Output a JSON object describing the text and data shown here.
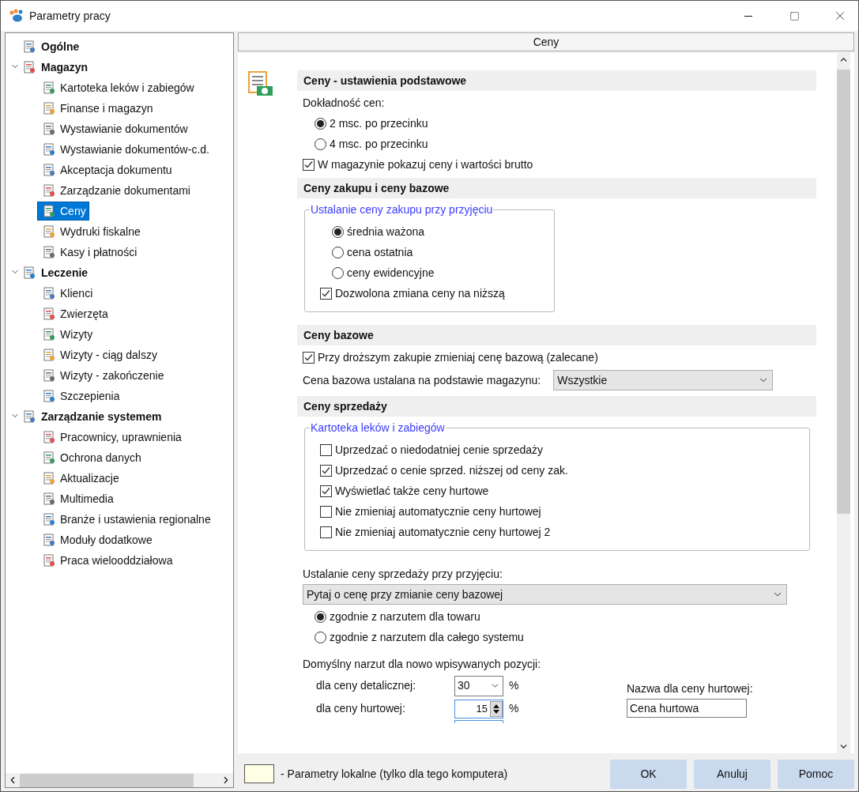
{
  "window": {
    "title": "Parametry pracy"
  },
  "tree": [
    {
      "label": "Ogólne",
      "selected": false
    },
    {
      "label": "Magazyn",
      "expanded": true,
      "selected": false,
      "children": [
        {
          "label": "Kartoteka leków i zabiegów",
          "selected": false
        },
        {
          "label": "Finanse i magazyn",
          "selected": false
        },
        {
          "label": "Wystawianie dokumentów",
          "selected": false
        },
        {
          "label": "Wystawianie dokumentów-c.d.",
          "selected": false
        },
        {
          "label": "Akceptacja dokumentu",
          "selected": false
        },
        {
          "label": "Zarządzanie dokumentami",
          "selected": false
        },
        {
          "label": "Ceny",
          "selected": true
        },
        {
          "label": "Wydruki fiskalne",
          "selected": false
        },
        {
          "label": "Kasy i płatności",
          "selected": false
        }
      ]
    },
    {
      "label": "Leczenie",
      "expanded": true,
      "selected": false,
      "children": [
        {
          "label": "Klienci",
          "selected": false
        },
        {
          "label": "Zwierzęta",
          "selected": false
        },
        {
          "label": "Wizyty",
          "selected": false
        },
        {
          "label": "Wizyty - ciąg dalszy",
          "selected": false
        },
        {
          "label": "Wizyty - zakończenie",
          "selected": false
        },
        {
          "label": "Szczepienia",
          "selected": false
        }
      ]
    },
    {
      "label": "Zarządzanie systemem",
      "expanded": true,
      "selected": false,
      "children": [
        {
          "label": "Pracownicy, uprawnienia",
          "selected": false
        },
        {
          "label": "Ochrona danych",
          "selected": false
        },
        {
          "label": "Aktualizacje",
          "selected": false
        },
        {
          "label": "Multimedia",
          "selected": false
        },
        {
          "label": "Branże i ustawienia regionalne",
          "selected": false
        },
        {
          "label": "Moduły dodatkowe",
          "selected": false
        },
        {
          "label": "Praca wielooddziałowa",
          "selected": false
        }
      ]
    }
  ],
  "page": {
    "title": "Ceny",
    "sections": [
      {
        "title": "Ceny - ustawienia podstawowe",
        "items": [
          {
            "kind": "label",
            "text": "Dokładność cen:"
          },
          {
            "kind": "radio",
            "text": "2 msc. po przecinku",
            "selected": true
          },
          {
            "kind": "radio",
            "text": "4 msc. po przecinku",
            "selected": false
          },
          {
            "kind": "checkbox",
            "text": "W magazynie pokazuj ceny i wartości brutto",
            "checked": true
          }
        ]
      },
      {
        "title": "Ceny zakupu i ceny bazowe",
        "items": [
          {
            "kind": "group",
            "title": "Ustalanie ceny zakupu przy przyjęciu",
            "items": [
              {
                "kind": "radio",
                "text": "średnia ważona",
                "selected": true
              },
              {
                "kind": "radio",
                "text": "cena ostatnia",
                "selected": false
              },
              {
                "kind": "radio",
                "text": "ceny ewidencyjne",
                "selected": false
              },
              {
                "kind": "checkbox",
                "text": "Dozwolona zmiana ceny na niższą",
                "checked": true
              }
            ]
          }
        ]
      },
      {
        "title": "Ceny bazowe",
        "items": [
          {
            "kind": "checkbox",
            "text": "Przy droższym zakupie zmieniaj cenę bazową (zalecane)",
            "checked": true
          },
          {
            "kind": "select_row",
            "text": "Cena bazowa ustalana na podstawie magazynu:",
            "value": "Wszystkie"
          }
        ]
      },
      {
        "title": "Ceny sprzedaży",
        "items": [
          {
            "kind": "group",
            "title": "Kartoteka leków i zabiegów",
            "items": [
              {
                "kind": "checkbox",
                "text": "Uprzedzać o niedodatniej cenie sprzedaży",
                "checked": false
              },
              {
                "kind": "checkbox",
                "text": "Uprzedzać o cenie sprzed. niższej od ceny zak.",
                "checked": true
              },
              {
                "kind": "checkbox",
                "text": "Wyświetlać także ceny hurtowe",
                "checked": true
              },
              {
                "kind": "checkbox",
                "text": "Nie zmieniaj automatycznie ceny hurtowej",
                "checked": false
              },
              {
                "kind": "checkbox",
                "text": "Nie zmieniaj automatycznie ceny hurtowej 2",
                "checked": false
              }
            ]
          },
          {
            "kind": "label",
            "text": "Ustalanie ceny sprzedaży przy przyjęciu:"
          },
          {
            "kind": "select",
            "value": "Pytaj o cenę przy zmianie ceny bazowej"
          },
          {
            "kind": "radio",
            "text": "zgodnie z narzutem dla towaru",
            "selected": true
          },
          {
            "kind": "radio",
            "text": "zgodnie z narzutem dla całego systemu",
            "selected": false
          },
          {
            "kind": "markup",
            "text": "Domyślny narzut dla nowo wpisywanych pozycji:",
            "rows": [
              {
                "kind": "combo",
                "label": "dla ceny detalicznej:",
                "value": "30",
                "unit": "%"
              },
              {
                "kind": "spin",
                "label": "dla ceny hurtowej:",
                "value": "15",
                "unit": "%"
              }
            ],
            "name_label": "Nazwa dla ceny hurtowej:",
            "name_value": "Cena hurtowa"
          }
        ]
      }
    ]
  },
  "footer": {
    "legend": "- Parametry lokalne (tylko dla tego komputera)",
    "buttons": [
      "OK",
      "Anuluj",
      "Pomoc"
    ]
  }
}
